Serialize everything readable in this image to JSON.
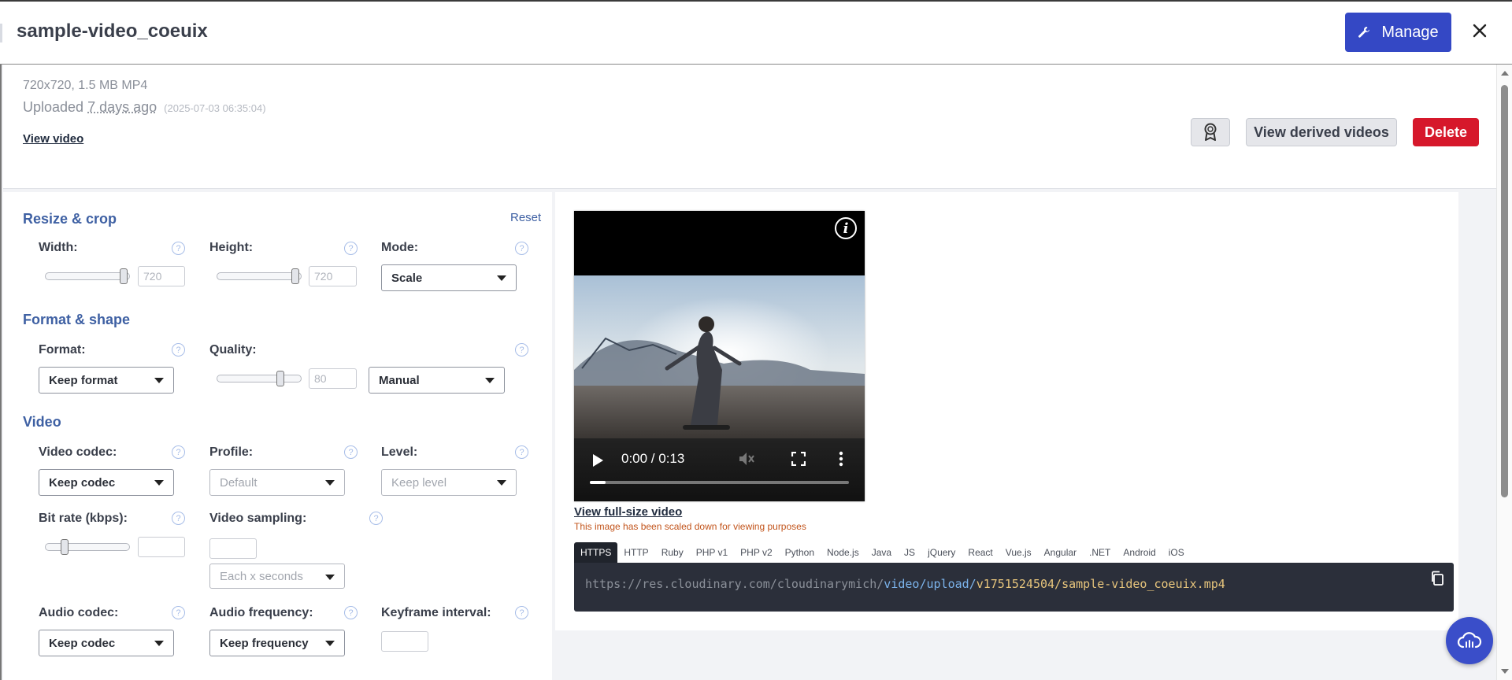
{
  "header": {
    "title": "sample-video_coeuix",
    "manage_label": "Manage"
  },
  "info": {
    "dimensions": "720x720, 1.5 MB MP4",
    "uploaded_prefix": "Uploaded",
    "uploaded_ago": "7 days ago",
    "uploaded_timestamp": "(2025-07-03 06:35:04)",
    "view_video": "View video",
    "view_derived": "View derived videos",
    "delete": "Delete"
  },
  "resize": {
    "title": "Resize & crop",
    "reset": "Reset",
    "width_label": "Width:",
    "width_value": "720",
    "width_level": 1.0,
    "height_label": "Height:",
    "height_value": "720",
    "height_level": 1.0,
    "mode_label": "Mode:",
    "mode_value": "Scale"
  },
  "format": {
    "title": "Format & shape",
    "format_label": "Format:",
    "format_value": "Keep format",
    "quality_label": "Quality:",
    "quality_value": "80",
    "quality_level": 0.8,
    "quality_mode": "Manual"
  },
  "video": {
    "title": "Video",
    "codec_label": "Video codec:",
    "codec_value": "Keep codec",
    "profile_label": "Profile:",
    "profile_value": "Default",
    "level_label": "Level:",
    "level_value": "Keep level",
    "bitrate_label": "Bit rate (kbps):",
    "bitrate_level": 0.2,
    "bitrate_value": "",
    "sampling_label": "Video sampling:",
    "sampling_value": "",
    "sampling_select": "Each x seconds",
    "audio_codec_label": "Audio codec:",
    "audio_codec_value": "Keep codec",
    "audio_freq_label": "Audio frequency:",
    "audio_freq_value": "Keep frequency",
    "keyframe_label": "Keyframe interval:",
    "keyframe_value": ""
  },
  "player": {
    "time": "0:00 / 0:13",
    "progress": 0.06,
    "full_size_link": "View full-size video",
    "scaled_note": "This image has been scaled down for viewing purposes"
  },
  "code_tabs": [
    "HTTPS",
    "HTTP",
    "Ruby",
    "PHP v1",
    "PHP v2",
    "Python",
    "Node.js",
    "Java",
    "JS",
    "jQuery",
    "React",
    "Vue.js",
    "Angular",
    ".NET",
    "Android",
    "iOS"
  ],
  "active_tab": "HTTPS",
  "url": {
    "part1": "https://res.cloudinary.com/cloudinarymich/",
    "part2": "video/upload/",
    "part3": "v1751524504/sample-video_coeuix.mp4"
  },
  "colors": {
    "accent": "#3448c5",
    "danger": "#d6182b",
    "section_title": "#3e60a3"
  },
  "icons": {
    "manage": "wrench-icon",
    "close": "close-icon",
    "award": "award-icon",
    "info": "info-icon",
    "play": "play-icon",
    "volume": "volume-icon",
    "fullscreen": "fullscreen-icon",
    "more": "more-vertical-icon",
    "copy": "copy-icon",
    "help": "help-icon",
    "fab": "cloud-upload-icon"
  }
}
